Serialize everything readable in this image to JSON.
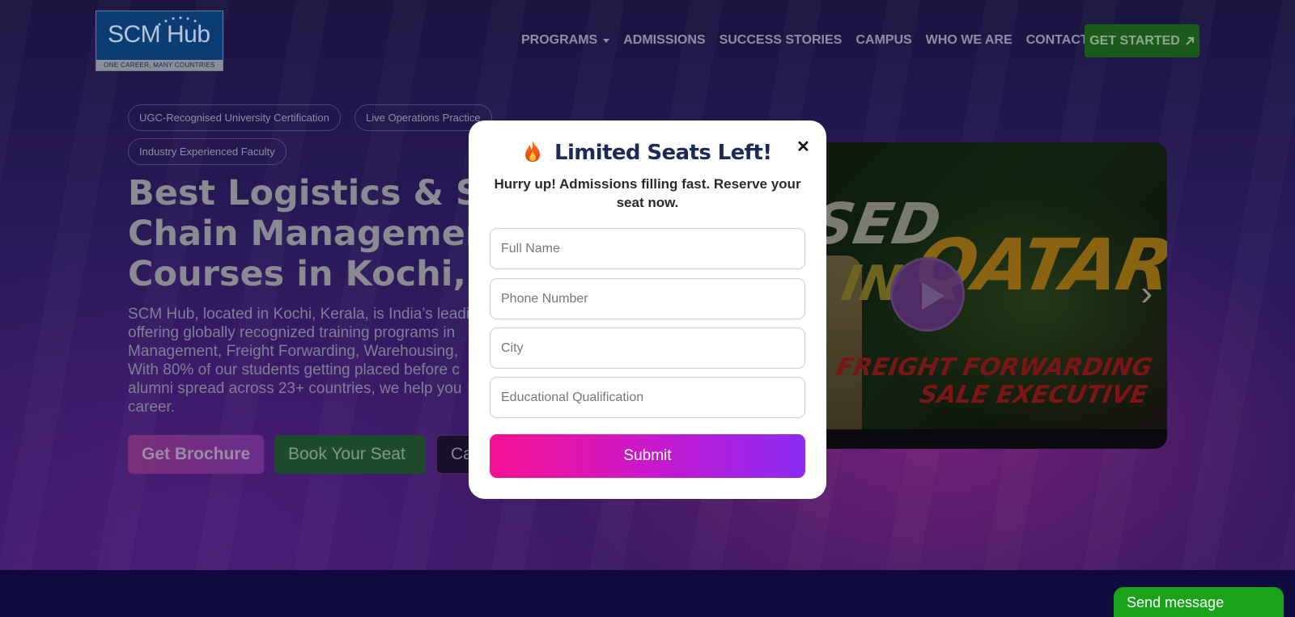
{
  "brand": {
    "logo_text": "SCM Hub",
    "logo_tagline": "ONE CAREER, MANY COUNTRIES"
  },
  "nav": {
    "items": [
      {
        "label": "PROGRAMS",
        "has_dropdown": true
      },
      {
        "label": "ADMISSIONS"
      },
      {
        "label": "SUCCESS STORIES"
      },
      {
        "label": "CAMPUS"
      },
      {
        "label": "WHO WE ARE"
      },
      {
        "label": "CONTACT"
      }
    ],
    "cta_label": "GET STARTED",
    "cta_icon": "arrow-up-right-icon"
  },
  "hero": {
    "tags": [
      "UGC-Recognised University Certification",
      "Live Operations Practice",
      "Industry Experienced Faculty"
    ],
    "title_lines": [
      "Best Logistics & S",
      "Chain Managemen",
      "Courses in Kochi,"
    ],
    "description_lines": [
      "SCM Hub, located in Kochi, Kerala, is India’s leadi",
      "offering globally recognized training programs in",
      "Management, Freight Forwarding, Warehousing,",
      "With 80% of our students getting placed before c",
      "alumni spread across 23+ countries, we help you",
      "career."
    ],
    "buttons": {
      "brochure": "Get Brochure",
      "seat": "Book Your Seat",
      "call": "Ca"
    }
  },
  "video": {
    "text_sed": "SED",
    "text_in": "IN",
    "text_qatar": "QATAR",
    "text_line1": "FREIGHT FORWARDING",
    "text_line2": "SALE EXECUTIVE",
    "next_glyph": "›"
  },
  "modal": {
    "title": "Limited Seats Left!",
    "title_icon": "fire-icon",
    "close_glyph": "✕",
    "subtitle": "Hurry up! Admissions filling fast. Reserve your seat now.",
    "fields": {
      "full_name_placeholder": "Full Name",
      "phone_placeholder": "Phone Number",
      "city_placeholder": "City",
      "qualification_placeholder": "Educational Qualification"
    },
    "submit_label": "Submit"
  },
  "chat": {
    "label": "Send message"
  },
  "colors": {
    "submit_gradient": [
      "#f7108f",
      "#8a2cf3"
    ],
    "cta_green": "#1c5a1c",
    "chat_green": "#1aa31a",
    "title_navy": "#1c2a5a"
  }
}
